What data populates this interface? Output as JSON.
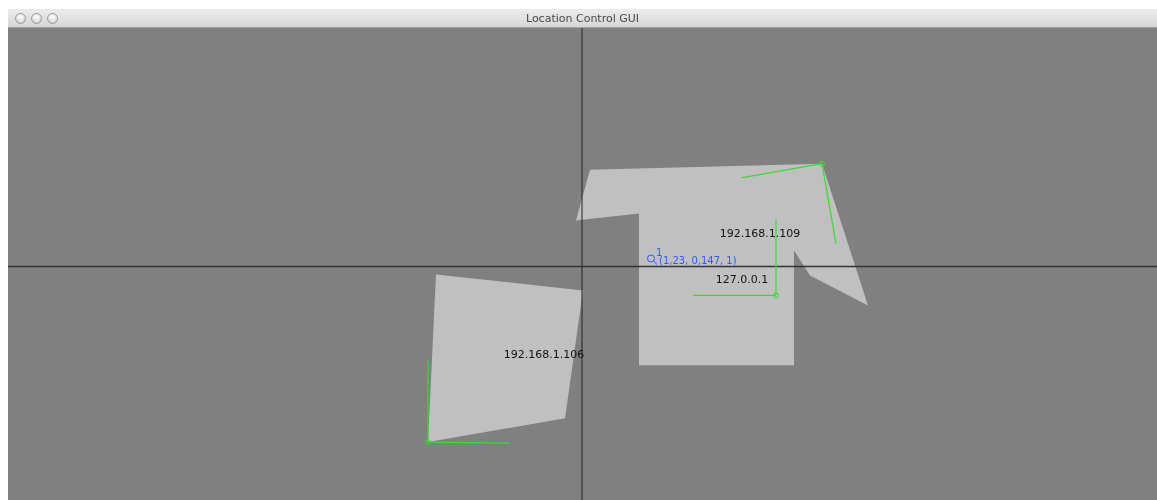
{
  "window": {
    "title": "Location Control GUI"
  },
  "robots": [
    {
      "label": "192.168.1.109",
      "kind": "tee"
    },
    {
      "label": "127.0.0.1",
      "kind": "axes"
    },
    {
      "label": "192.168.1.106",
      "kind": "quad"
    }
  ],
  "target": {
    "id": "1",
    "coords": "(1,23, 0,147, 1)"
  }
}
